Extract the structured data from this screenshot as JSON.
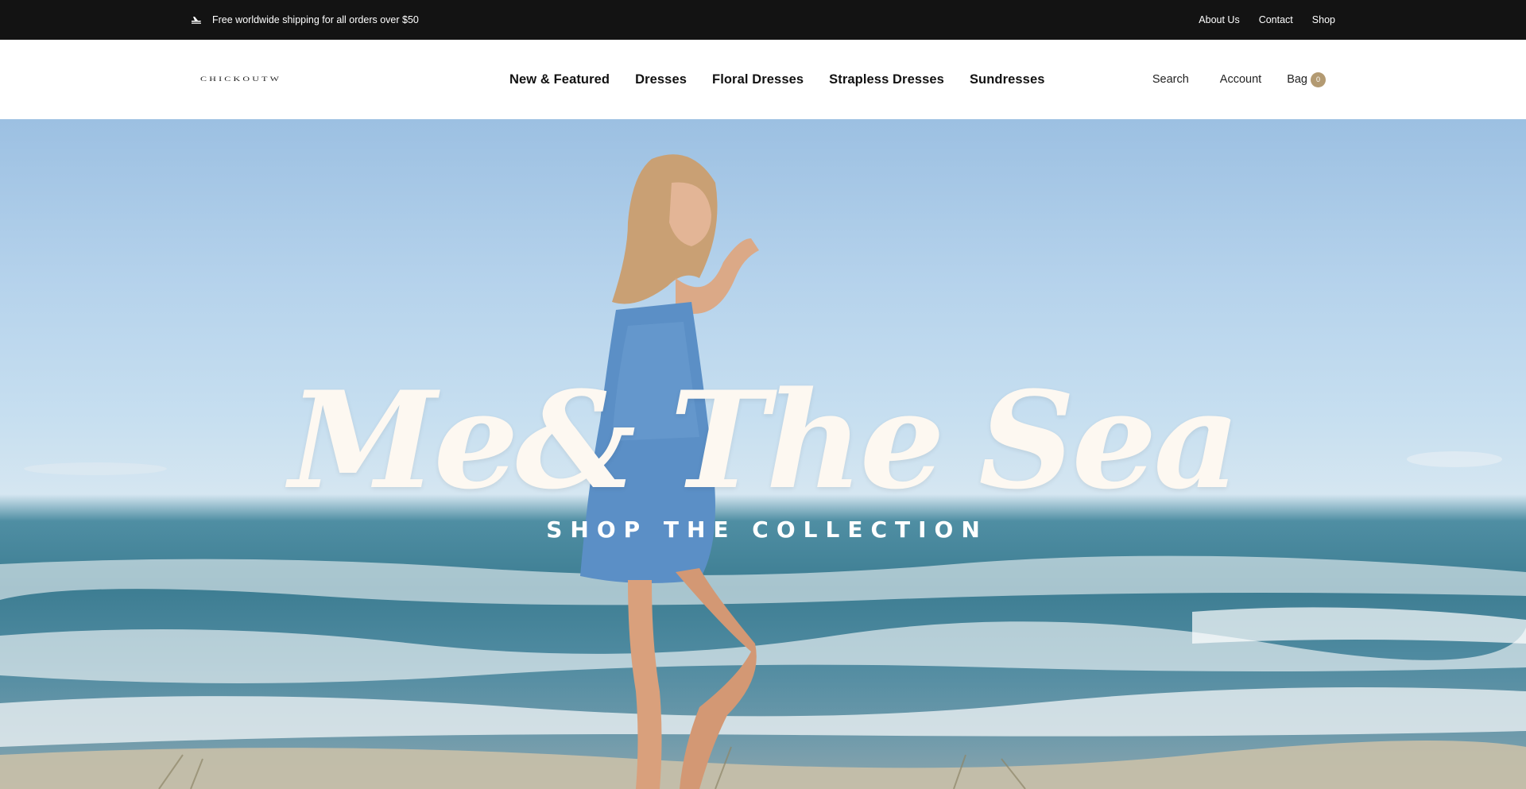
{
  "announcement": {
    "shipping_icon": "airplane-icon",
    "text": "Free worldwide shipping for all orders over $50",
    "links": [
      "About Us",
      "Contact",
      "Shop"
    ]
  },
  "header": {
    "logo_text": "CHICKOUTW",
    "nav": [
      "New & Featured",
      "Dresses",
      "Floral Dresses",
      "Strapless Dresses",
      "Sundresses"
    ],
    "search_label": "Search",
    "account_label": "Account",
    "bag_label": "Bag",
    "bag_count": "0"
  },
  "hero": {
    "title": "Me& The Sea",
    "subtitle": "SHOP THE COLLECTION"
  },
  "colors": {
    "topbar_bg": "#131313",
    "bag_badge": "#b39a72",
    "hero_text": "#fdf8f1"
  }
}
